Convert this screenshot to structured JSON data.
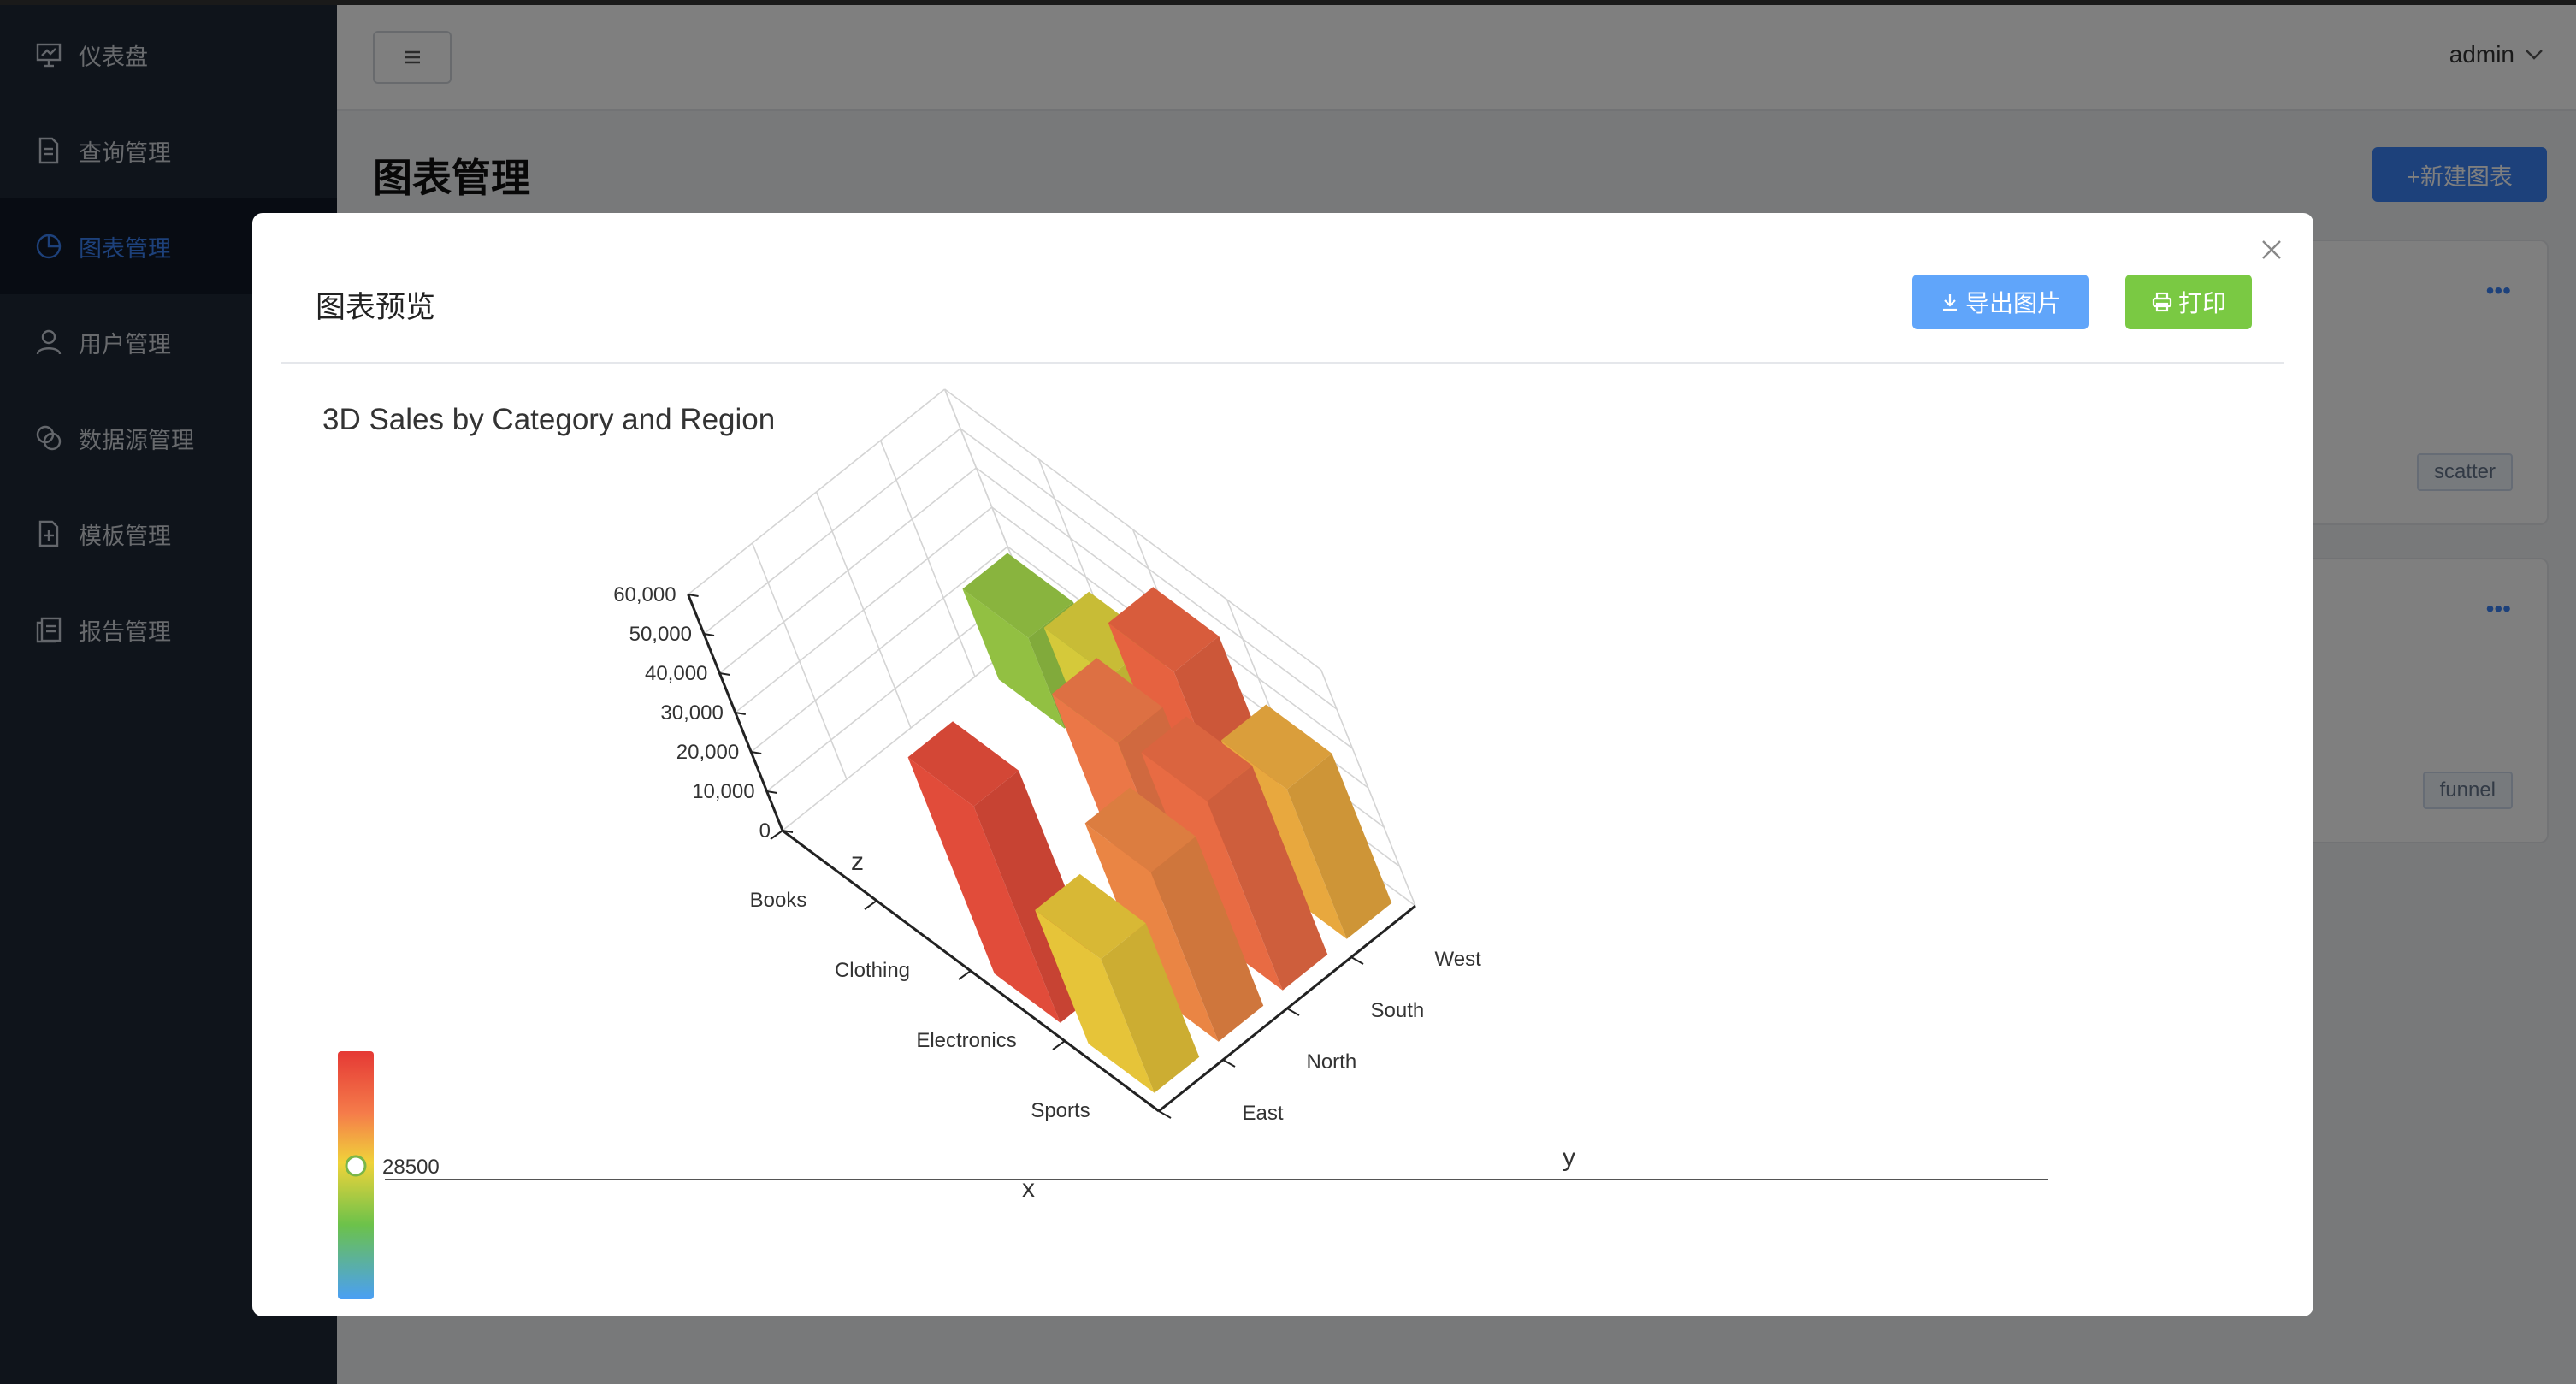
{
  "sidebar": {
    "items": [
      {
        "label": "仪表盘",
        "icon": "dashboard-icon"
      },
      {
        "label": "查询管理",
        "icon": "document-icon"
      },
      {
        "label": "图表管理",
        "icon": "pie-chart-icon",
        "active": true
      },
      {
        "label": "用户管理",
        "icon": "user-icon"
      },
      {
        "label": "数据源管理",
        "icon": "datasource-icon"
      },
      {
        "label": "模板管理",
        "icon": "template-icon"
      },
      {
        "label": "报告管理",
        "icon": "report-icon"
      }
    ]
  },
  "header": {
    "user": "admin"
  },
  "page": {
    "title": "图表管理",
    "new_button": "+新建图表"
  },
  "cards": [
    {
      "tag": "scatter",
      "more": "•••"
    },
    {
      "tag": "funnel",
      "more": "•••"
    }
  ],
  "modal": {
    "title": "图表预览",
    "export_button": "导出图片",
    "print_button": "打印"
  },
  "colors": {
    "accent": "#3b82f6",
    "export": "#60a5fa",
    "print": "#7ac943",
    "sidebar": "#1f2937"
  },
  "chart_data": {
    "type": "bar3d",
    "title": "3D Sales by Category and Region",
    "x_axis_label": "x",
    "y_axis_label": "y",
    "z_axis_label": "z",
    "x_categories": [
      "Books",
      "Clothing",
      "Electronics",
      "Sports"
    ],
    "y_categories": [
      "East",
      "North",
      "South",
      "West"
    ],
    "z_ticks": [
      "0",
      "10,000",
      "20,000",
      "30,000",
      "40,000",
      "50,000",
      "60,000"
    ],
    "zlim": [
      0,
      60000
    ],
    "visual_map": {
      "value": "28500"
    },
    "bars": [
      {
        "x": "Books",
        "y": "West",
        "value": 23000
      },
      {
        "x": "Clothing",
        "y": "West",
        "value": 31000
      },
      {
        "x": "Electronics",
        "y": "West",
        "value": 50000
      },
      {
        "x": "Electronics",
        "y": "South",
        "value": 45000
      },
      {
        "x": "Sports",
        "y": "South",
        "value": 48000
      },
      {
        "x": "Sports",
        "y": "North",
        "value": 43000
      },
      {
        "x": "Electronics",
        "y": "East",
        "value": 55000
      },
      {
        "x": "Sports",
        "y": "East",
        "value": 34000
      },
      {
        "x": "Sports",
        "y": "West",
        "value": 38000
      }
    ]
  }
}
